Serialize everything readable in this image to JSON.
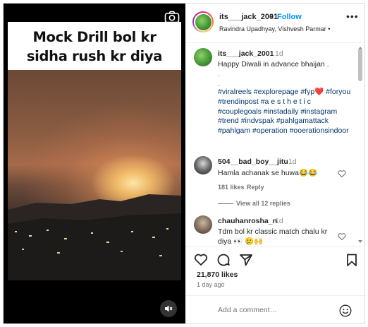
{
  "media": {
    "caption_line1": "Mock Drill bol kr",
    "caption_line2": "sidha rush kr diya",
    "icons": [
      "camera-icon",
      "mute-icon"
    ]
  },
  "header": {
    "username": "its___jack_2001",
    "separator": "•",
    "follow_label": "Follow",
    "subtitle": "Ravindra Upadhyay, Vishvesh Parmar •",
    "more_icon": "more-options-icon"
  },
  "caption": {
    "username": "its___jack_2001",
    "time": "1d",
    "line1": "Happy Diwali in advance bhaijan .",
    "line2": ".",
    "line3": ".",
    "hashtags": "#viralreels #explorepage #fyp❤️ #foryou #trendinpost #a e s t h e t i c #couplegoals #instadaily #instagram #trend #indvspak #pahlgamattack #pahlgam #operation #ooerationsindoor"
  },
  "comments": [
    {
      "username": "504__bad_boy__jitu",
      "time": "1d",
      "text": "Hamla achanak se huwa😂😂",
      "likes": "181 likes",
      "reply": "Reply",
      "view_replies": "View all 12 replies"
    },
    {
      "username": "chauhanrosha_n",
      "time": "1d",
      "text": "Tdm bol kr classic match chalu kr",
      "text2": "diya 👀 🥲🙌"
    }
  ],
  "actions": {
    "icons": [
      "heart-icon",
      "comment-icon",
      "share-icon",
      "bookmark-icon"
    ],
    "likes": "21,870 likes",
    "time_ago": "1 day ago",
    "add_comment_placeholder": "Add a comment…",
    "emoji_icon": "emoji-icon"
  },
  "colors": {
    "follow": "#0095f6",
    "hashtag": "#00376b",
    "muted": "#8e8e8e"
  }
}
